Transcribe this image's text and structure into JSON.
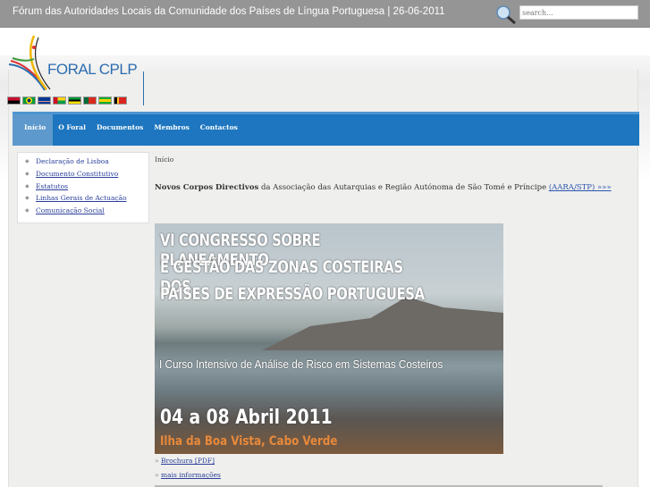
{
  "header": {
    "title": "Fórum das Autoridades Locais da Comunidade dos Países de Língua Portuguesa | 26-06-2011",
    "search_placeholder": "search..."
  },
  "logo": {
    "text": "FORAL CPLP"
  },
  "flags": [
    {
      "name": "angola",
      "color": "#c8102e"
    },
    {
      "name": "brazil",
      "color": "#009c3b"
    },
    {
      "name": "cape-verde",
      "color": "#003893"
    },
    {
      "name": "guinea-bissau",
      "color": "#fcd116"
    },
    {
      "name": "mozambique",
      "color": "#009739"
    },
    {
      "name": "portugal",
      "color": "#da291c"
    },
    {
      "name": "sao-tome",
      "color": "#12ad2b"
    },
    {
      "name": "timor-leste",
      "color": "#dc241f"
    }
  ],
  "nav": [
    "Início",
    "O Foral",
    "Documentos",
    "Membros",
    "Contactos"
  ],
  "sidebar": [
    "Declaração de Lisboa",
    "Documento Constitutivo",
    "Estatutos",
    "Linhas Gerais de Actuação",
    "Comunicação Social"
  ],
  "content": {
    "breadcrumb": "Início",
    "news_bold": "Novos Corpos Directivos",
    "news_text": " da Associação das Autarquias e Região Autónoma de São Tomé e Príncipe ",
    "news_link": "(AARA/STP) »»»",
    "banner": {
      "line1": "VI CONGRESSO SOBRE PLANEAMENTO",
      "line2": "E GESTÃO DAS ZONAS COSTEIRAS DOS",
      "line3": "PAÍSES DE EXPRESSÃO PORTUGUESA",
      "subtitle": "I Curso Intensivo de Análise de Risco em Sistemas Costeiros",
      "dates": "04 a 08 Abril 2011",
      "place": "Ilha da Boa Vista, Cabo Verde"
    },
    "links": [
      {
        "prefix": "» ",
        "label": "Brochura [PDF]"
      },
      {
        "prefix": "» ",
        "label": "mais informações"
      }
    ]
  }
}
